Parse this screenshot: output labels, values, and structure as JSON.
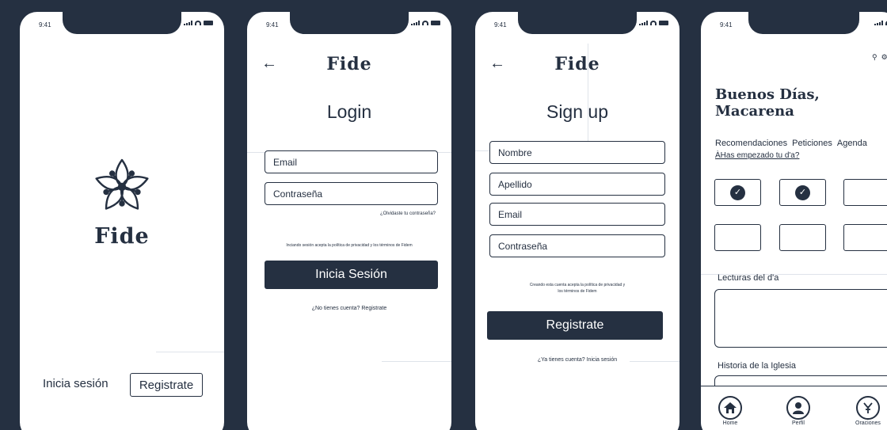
{
  "status": {
    "time": "9:41"
  },
  "brand": "Fide",
  "splash": {
    "login_label": "Inicia sesión",
    "register_label": "Registrate"
  },
  "login": {
    "back_icon": "arrow-left-icon",
    "title": "Login",
    "email_placeholder": "Email",
    "password_placeholder": "Contraseña",
    "forgot": "¿Olvidaste tu contraseña?",
    "legal": "Inciando sesión acepta la política de privacidad y los términos de Fidem",
    "submit": "Inicia Sesión",
    "alt_link": "¿No tienes cuenta? Registrate"
  },
  "signup": {
    "back_icon": "arrow-left-icon",
    "title": "Sign up",
    "name_placeholder": "Nombre",
    "lastname_placeholder": "Apellido",
    "email_placeholder": "Email",
    "password_placeholder": "Contraseña",
    "legal_line1": "Creando esta cuenta acepta la política de privacidad y",
    "legal_line2": "los términos de Fidem",
    "submit": "Registrate",
    "alt_link": "¿Ya tienes cuenta? Inicia sesión"
  },
  "home": {
    "greeting_line1": "Buenos Días,",
    "greeting_line2": "Macarena",
    "tabs": [
      "Recomendaciones",
      "Peticiones",
      "Agenda"
    ],
    "question": "ÀHas empezado tu d'a?",
    "checks": [
      true,
      true,
      false,
      false,
      false,
      false
    ],
    "section1": "Lecturas del d'a",
    "section2": "Historia de la Iglesia",
    "nav": [
      {
        "label": "Home",
        "icon": "home-icon"
      },
      {
        "label": "Perfil",
        "icon": "user-icon"
      },
      {
        "label": "Oraciones",
        "icon": "prayer-icon"
      }
    ]
  },
  "colors": {
    "navy": "#253041",
    "white": "#ffffff"
  }
}
